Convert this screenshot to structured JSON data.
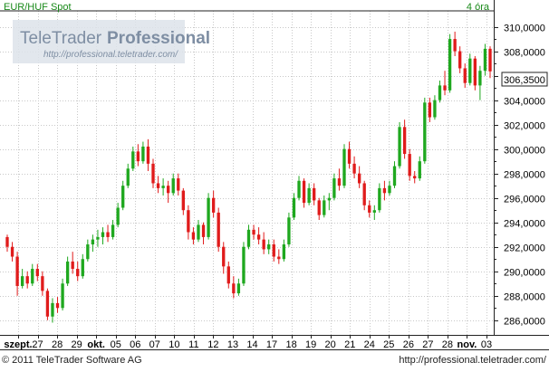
{
  "header": {
    "instrument": "EUR/HUF Spot",
    "interval": "4 óra"
  },
  "watermark": {
    "brand_a": "TeleTrader",
    "brand_b": "Professional",
    "url": "http://professional.teletrader.com/"
  },
  "footer": {
    "copyright": "© 2011 TeleTrader Software AG",
    "url": "http://professional.teletrader.com/"
  },
  "colors": {
    "up": "#1fa81f",
    "down": "#e01b1b",
    "axis": "#222222",
    "grid": "#c8c8c8",
    "label_bg": "#ffffff"
  },
  "chart_data": {
    "type": "candlestick",
    "title": "EUR/HUF Spot",
    "interval": "4 óra",
    "ylim": [
      284.8,
      311.3
    ],
    "y_ticks": [
      "286,0000",
      "288,0000",
      "290,0000",
      "292,0000",
      "294,0000",
      "296,0000",
      "298,0000",
      "300,0000",
      "302,0000",
      "304,0000",
      "306,0000",
      "308,0000",
      "310,0000"
    ],
    "last_price": "306,3500",
    "grid": true,
    "x_labels": [
      "szept.",
      "27",
      "28",
      "29",
      "okt.",
      "05",
      "06",
      "07",
      "10",
      "11",
      "12",
      "13",
      "14",
      "17",
      "18",
      "19",
      "20",
      "21",
      "24",
      "25",
      "26",
      "27",
      "28",
      "nov.",
      "03"
    ],
    "candles": [
      [
        292.8,
        293.0,
        291.6,
        292.0
      ],
      [
        292.0,
        292.4,
        290.8,
        291.2
      ],
      [
        291.2,
        291.6,
        288.0,
        288.8
      ],
      [
        288.8,
        290.2,
        288.6,
        289.6
      ],
      [
        289.6,
        290.0,
        288.6,
        289.0
      ],
      [
        289.0,
        290.6,
        288.8,
        290.2
      ],
      [
        290.2,
        290.6,
        289.2,
        289.6
      ],
      [
        289.6,
        290.0,
        288.0,
        288.4
      ],
      [
        288.4,
        288.6,
        286.0,
        286.3
      ],
      [
        286.3,
        287.8,
        285.8,
        287.4
      ],
      [
        287.4,
        287.9,
        286.6,
        287.0
      ],
      [
        287.0,
        289.4,
        286.8,
        289.0
      ],
      [
        289.0,
        291.2,
        288.8,
        290.8
      ],
      [
        290.8,
        291.6,
        289.8,
        290.2
      ],
      [
        290.2,
        290.8,
        289.2,
        289.6
      ],
      [
        289.6,
        291.4,
        289.4,
        291.0
      ],
      [
        291.0,
        292.6,
        290.8,
        292.2
      ],
      [
        292.2,
        293.0,
        291.6,
        292.6
      ],
      [
        292.6,
        293.4,
        292.0,
        292.8
      ],
      [
        292.8,
        293.6,
        292.2,
        293.2
      ],
      [
        293.2,
        293.8,
        292.4,
        292.8
      ],
      [
        292.8,
        294.2,
        292.6,
        293.8
      ],
      [
        293.8,
        295.6,
        293.6,
        295.2
      ],
      [
        295.2,
        297.4,
        295.0,
        297.0
      ],
      [
        297.0,
        298.8,
        296.8,
        298.4
      ],
      [
        298.4,
        300.2,
        298.2,
        299.8
      ],
      [
        299.8,
        300.4,
        298.6,
        299.0
      ],
      [
        299.0,
        300.6,
        298.8,
        300.2
      ],
      [
        300.2,
        300.8,
        298.2,
        298.8
      ],
      [
        298.8,
        299.2,
        296.8,
        297.2
      ],
      [
        297.2,
        297.8,
        296.4,
        296.8
      ],
      [
        296.8,
        297.6,
        296.2,
        297.0
      ],
      [
        297.0,
        297.4,
        295.6,
        296.4
      ],
      [
        296.4,
        298.0,
        296.2,
        297.6
      ],
      [
        297.6,
        298.0,
        296.2,
        296.6
      ],
      [
        296.6,
        296.8,
        294.6,
        295.0
      ],
      [
        295.0,
        295.4,
        292.6,
        293.2
      ],
      [
        293.2,
        293.6,
        292.2,
        292.6
      ],
      [
        292.6,
        294.2,
        292.4,
        293.8
      ],
      [
        293.8,
        294.0,
        292.2,
        292.8
      ],
      [
        292.8,
        296.4,
        292.6,
        296.0
      ],
      [
        296.0,
        296.6,
        294.4,
        294.8
      ],
      [
        294.8,
        295.2,
        291.6,
        292.0
      ],
      [
        292.0,
        292.4,
        289.8,
        290.4
      ],
      [
        290.4,
        290.8,
        288.6,
        289.0
      ],
      [
        289.0,
        289.6,
        287.8,
        288.2
      ],
      [
        288.2,
        289.4,
        288.0,
        289.0
      ],
      [
        289.0,
        292.4,
        288.8,
        292.0
      ],
      [
        292.0,
        293.8,
        291.8,
        293.4
      ],
      [
        293.4,
        293.8,
        292.6,
        293.0
      ],
      [
        293.0,
        293.6,
        292.2,
        292.6
      ],
      [
        292.6,
        293.2,
        291.4,
        291.8
      ],
      [
        291.8,
        292.6,
        291.4,
        292.2
      ],
      [
        292.2,
        292.6,
        290.8,
        291.2
      ],
      [
        291.2,
        291.8,
        290.6,
        291.0
      ],
      [
        291.0,
        292.6,
        290.8,
        292.2
      ],
      [
        292.2,
        294.8,
        292.0,
        294.4
      ],
      [
        294.4,
        296.4,
        294.2,
        296.0
      ],
      [
        296.0,
        297.8,
        295.8,
        297.4
      ],
      [
        297.4,
        297.6,
        295.2,
        295.6
      ],
      [
        295.6,
        297.2,
        295.4,
        296.8
      ],
      [
        296.8,
        297.2,
        295.4,
        295.8
      ],
      [
        295.8,
        296.0,
        294.2,
        294.6
      ],
      [
        294.6,
        296.2,
        294.4,
        295.8
      ],
      [
        295.8,
        296.4,
        295.0,
        296.0
      ],
      [
        296.0,
        298.0,
        295.8,
        297.6
      ],
      [
        297.6,
        298.4,
        296.6,
        297.0
      ],
      [
        297.0,
        300.4,
        296.8,
        300.0
      ],
      [
        300.0,
        300.6,
        298.4,
        298.8
      ],
      [
        298.8,
        299.4,
        297.6,
        298.0
      ],
      [
        298.0,
        298.6,
        296.8,
        297.2
      ],
      [
        297.2,
        297.4,
        295.0,
        295.4
      ],
      [
        295.4,
        295.8,
        294.4,
        294.8
      ],
      [
        294.8,
        295.4,
        294.2,
        295.0
      ],
      [
        295.0,
        297.2,
        294.8,
        296.8
      ],
      [
        296.8,
        297.4,
        295.8,
        296.4
      ],
      [
        296.4,
        297.4,
        296.2,
        297.0
      ],
      [
        297.0,
        299.0,
        296.8,
        298.6
      ],
      [
        298.6,
        302.2,
        298.4,
        301.8
      ],
      [
        301.8,
        302.4,
        299.2,
        299.6
      ],
      [
        299.6,
        300.0,
        297.4,
        297.8
      ],
      [
        297.8,
        298.2,
        297.2,
        297.6
      ],
      [
        297.6,
        299.4,
        297.4,
        299.0
      ],
      [
        299.0,
        304.2,
        298.8,
        303.8
      ],
      [
        303.8,
        304.2,
        302.2,
        302.6
      ],
      [
        302.6,
        304.4,
        302.4,
        304.0
      ],
      [
        304.0,
        305.6,
        303.8,
        305.2
      ],
      [
        305.2,
        306.4,
        304.4,
        304.8
      ],
      [
        304.8,
        309.4,
        304.6,
        309.0
      ],
      [
        309.0,
        309.6,
        307.6,
        308.0
      ],
      [
        308.0,
        308.4,
        306.2,
        306.6
      ],
      [
        306.6,
        307.0,
        305.0,
        305.4
      ],
      [
        305.4,
        307.8,
        305.2,
        307.4
      ],
      [
        307.4,
        307.6,
        304.8,
        305.2
      ],
      [
        305.2,
        306.8,
        304.0,
        306.4
      ],
      [
        306.4,
        308.6,
        306.0,
        308.2
      ],
      [
        308.2,
        308.4,
        305.8,
        306.35
      ]
    ]
  }
}
